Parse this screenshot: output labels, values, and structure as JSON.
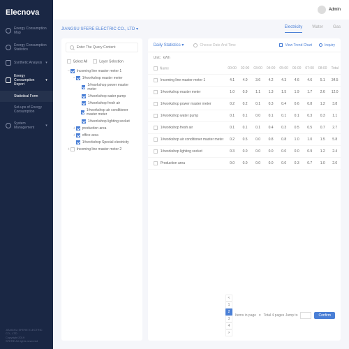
{
  "logo": "Elecnova",
  "user": "Admin",
  "sidebar": {
    "items": [
      {
        "label": "Energy Consumption Map"
      },
      {
        "label": "Energy Consumption Statistics"
      },
      {
        "label": "Synthetic Analysis"
      },
      {
        "label": "Energy Consumption Report"
      },
      {
        "label": "System Management"
      }
    ],
    "subs": [
      {
        "label": "Statistical Form"
      },
      {
        "label": "Set-ups of Energy Consumption"
      }
    ]
  },
  "footer": {
    "company": "JIANGSU SFERE ELECTRIC CO., LTD",
    "copy": "Copyright 2019",
    "rights": "SFERE All rights reserved"
  },
  "breadcrumb": "JIANGSU SFERE ELECTRIC CO., LTD ▾",
  "tabs": [
    "Electricity",
    "Water",
    "Gas"
  ],
  "search": {
    "placeholder": "Enter The Query Content"
  },
  "tree_controls": {
    "select_all": "Select All",
    "layer": "Layer Selection"
  },
  "tree": [
    {
      "lvl": 0,
      "caret": "–",
      "chk": true,
      "label": "Incoming line master meter 1"
    },
    {
      "lvl": 1,
      "caret": "–",
      "chk": true,
      "label": "1#workshop master meter"
    },
    {
      "lvl": 2,
      "caret": "",
      "chk": true,
      "label": "1#workshop power master meter"
    },
    {
      "lvl": 2,
      "caret": "",
      "chk": true,
      "label": "1#workshop water pump"
    },
    {
      "lvl": 2,
      "caret": "",
      "chk": true,
      "label": "1#workshop fresh air"
    },
    {
      "lvl": 2,
      "caret": "",
      "chk": true,
      "label": "1#workshop air conditioner master meter"
    },
    {
      "lvl": 2,
      "caret": "",
      "chk": true,
      "label": "1#workshop lighting socket"
    },
    {
      "lvl": 1,
      "caret": "+",
      "chk": true,
      "label": "production area"
    },
    {
      "lvl": 1,
      "caret": "+",
      "chk": true,
      "label": "office area"
    },
    {
      "lvl": 1,
      "caret": "",
      "chk": true,
      "label": "1#workshop Special electricity"
    },
    {
      "lvl": 0,
      "caret": "+",
      "chk": false,
      "label": "Incoming line master meter 2"
    }
  ],
  "panel": {
    "daily": "Daily Statistics ▾",
    "date_hint": "Choose Date And Time",
    "view_trend": "View Trend Chart",
    "inquiry": "Inquiry",
    "unit": "Unit：kWh"
  },
  "table": {
    "headers": [
      "Name",
      "00:00",
      "02:00",
      "03:00",
      "04:00",
      "05:00",
      "06:00",
      "07:00",
      "08:00",
      "Total"
    ],
    "rows": [
      {
        "name": "Incoming line master meter 1",
        "v": [
          "4.1",
          "4.0",
          "3.6",
          "4.2",
          "4.3",
          "4.6",
          "4.6",
          "5.1",
          "34.5"
        ]
      },
      {
        "name": "1#workshop master meter",
        "v": [
          "1.0",
          "0.9",
          "1.1",
          "1.3",
          "1.5",
          "1.9",
          "1.7",
          "2.6",
          "12.0"
        ]
      },
      {
        "name": "1#workshop power master meter",
        "v": [
          "0.2",
          "0.2",
          "0.1",
          "0.3",
          "0.4",
          "0.6",
          "0.8",
          "1.2",
          "3.8"
        ]
      },
      {
        "name": "1#workshop water pump",
        "v": [
          "0.1",
          "0.1",
          "0.0",
          "0.1",
          "0.1",
          "0.1",
          "0.3",
          "0.3",
          "1.1"
        ]
      },
      {
        "name": "1#workshop fresh air",
        "v": [
          "0.1",
          "0.1",
          "0.1",
          "0.4",
          "0.3",
          "0.5",
          "0.5",
          "0.7",
          "2.7"
        ]
      },
      {
        "name": "1#workshop air conditioner master meter",
        "v": [
          "0.2",
          "0.5",
          "0.0",
          "0.8",
          "0.8",
          "1.0",
          "1.0",
          "1.5",
          "5.8"
        ]
      },
      {
        "name": "1#workshop lighting socket",
        "v": [
          "0.3",
          "0.0",
          "0.0",
          "0.0",
          "0.0",
          "0.0",
          "0.9",
          "1.2",
          "2.4"
        ]
      },
      {
        "name": "Production area",
        "v": [
          "0.0",
          "0.0",
          "0.0",
          "0.0",
          "0.0",
          "0.3",
          "0.7",
          "1.0",
          "2.0"
        ]
      }
    ]
  },
  "pager": {
    "pages": [
      "<",
      "1",
      "2",
      "3",
      "4",
      ">"
    ],
    "active": 2,
    "items_label": "Items in page",
    "total_label": "Total 4 pages Jump to",
    "confirm": "Confirm"
  }
}
